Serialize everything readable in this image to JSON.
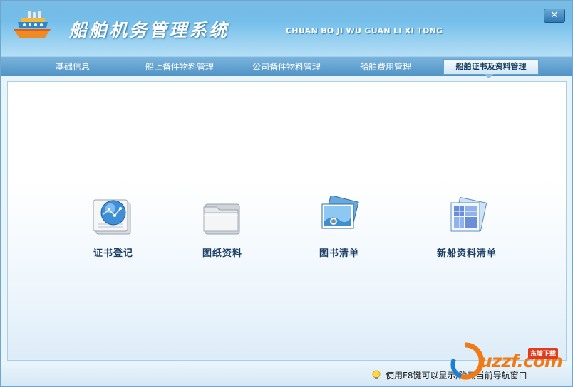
{
  "app": {
    "title": "船舶机务管理系统",
    "subtitle": "CHUAN BO JI WU GUAN LI XI TONG",
    "close_symbol": "✕"
  },
  "tabs": [
    {
      "label": "基础信息",
      "active": false
    },
    {
      "label": "船上备件物料管理",
      "active": false
    },
    {
      "label": "公司备件物料管理",
      "active": false
    },
    {
      "label": "船舶费用管理",
      "active": false
    },
    {
      "label": "船舶证书及资料管理",
      "active": true
    }
  ],
  "items": [
    {
      "label": "证书登记",
      "icon": "globe-document-icon"
    },
    {
      "label": "图纸资料",
      "icon": "folder-icon"
    },
    {
      "label": "图书清单",
      "icon": "picture-stack-icon"
    },
    {
      "label": "新船资料清单",
      "icon": "grid-document-icon"
    }
  ],
  "status": {
    "hint": "使用F8键可以显示/隐藏当前导航窗口"
  },
  "watermark": {
    "text": "uzzf.com",
    "badge": "东坡下载"
  },
  "colors": {
    "header": "#4da7dd",
    "tabbar": "#4f93c6",
    "item_text": "#1d3f66",
    "watermark": "#f07a16"
  }
}
